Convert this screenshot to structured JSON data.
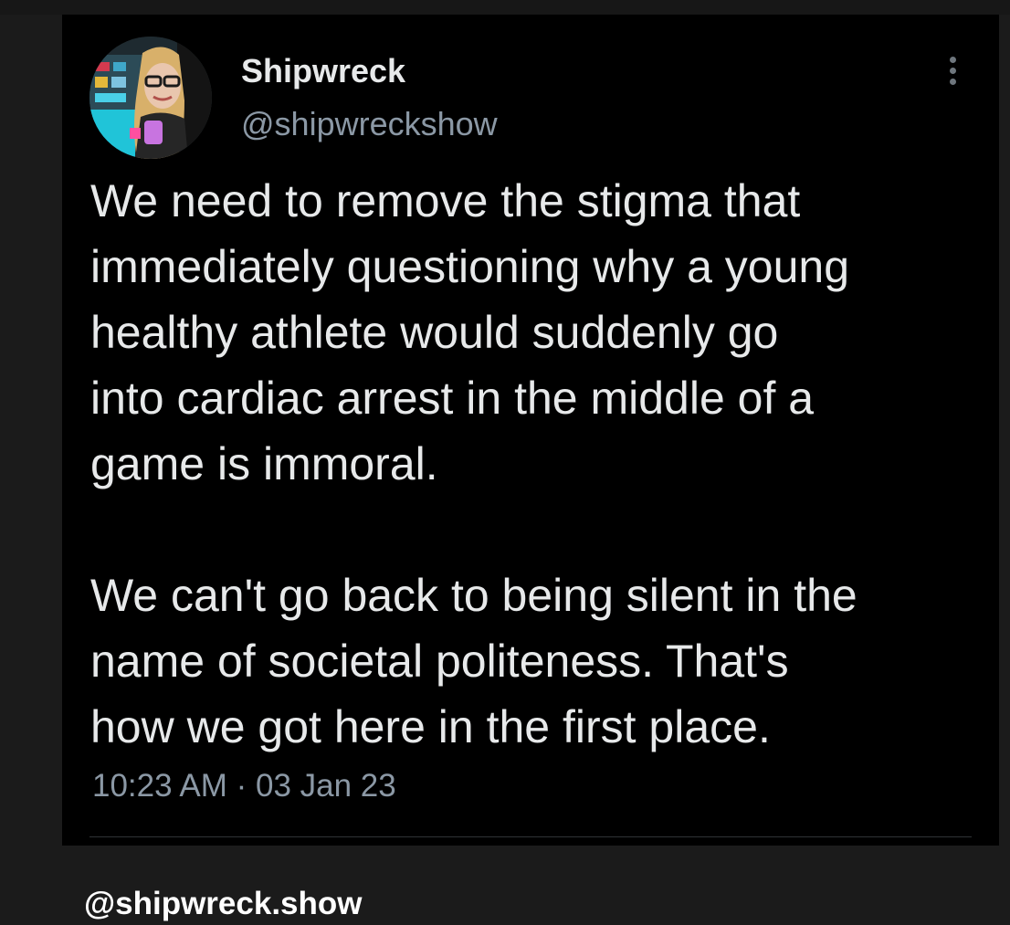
{
  "tweet": {
    "author": {
      "display_name": "Shipwreck",
      "handle": "@shipwreckshow"
    },
    "paragraphs": [
      "We need to remove the stigma that\nimmediately questioning why a young\nhealthy athlete would suddenly go\ninto cardiac arrest in the middle of a\ngame is immoral.",
      "We can't go back to being silent in the\nname of societal politeness. That's\nhow we got here in the first place."
    ],
    "timestamp": "10:23 AM · 03 Jan 23",
    "more_icon": "more-vertical-icon"
  },
  "watermark": "@shipwreck.show",
  "colors": {
    "background": "#1b1b1b",
    "card": "#000000",
    "primary_text": "#e7e9ea",
    "secondary_text": "#8b98a5",
    "divider": "#2f3336"
  }
}
